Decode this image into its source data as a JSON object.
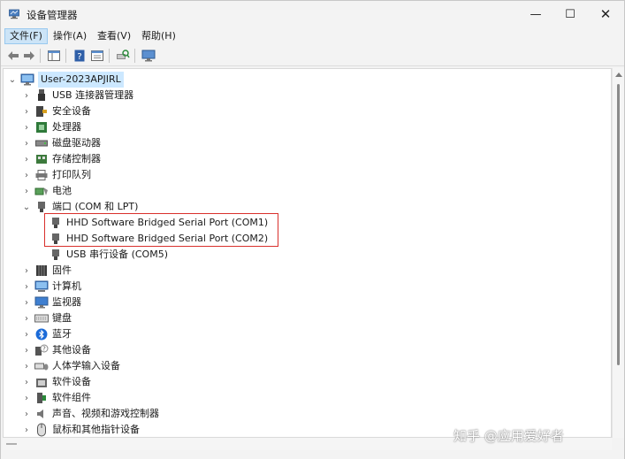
{
  "window": {
    "title": "设备管理器",
    "minimize_glyph": "—",
    "maximize_glyph": "☐",
    "close_glyph": "✕"
  },
  "menu": [
    {
      "label": "文件(F)"
    },
    {
      "label": "操作(A)"
    },
    {
      "label": "查看(V)"
    },
    {
      "label": "帮助(H)"
    }
  ],
  "tree": {
    "root": "User-2023APJIRL",
    "items": [
      {
        "label": "USB 连接器管理器",
        "icon": "usb-connector-icon"
      },
      {
        "label": "安全设备",
        "icon": "security-device-icon"
      },
      {
        "label": "处理器",
        "icon": "processor-icon"
      },
      {
        "label": "磁盘驱动器",
        "icon": "disk-drive-icon"
      },
      {
        "label": "存储控制器",
        "icon": "storage-controller-icon"
      },
      {
        "label": "打印队列",
        "icon": "printer-icon"
      },
      {
        "label": "电池",
        "icon": "battery-icon"
      },
      {
        "label": "端口 (COM 和 LPT)",
        "icon": "port-icon"
      },
      {
        "label": "HHD Software Bridged Serial Port (COM1)",
        "icon": "serial-port-icon"
      },
      {
        "label": "HHD Software Bridged Serial Port (COM2)",
        "icon": "serial-port-icon"
      },
      {
        "label": "USB 串行设备 (COM5)",
        "icon": "serial-port-icon"
      },
      {
        "label": "固件",
        "icon": "firmware-icon"
      },
      {
        "label": "计算机",
        "icon": "computer-icon"
      },
      {
        "label": "监视器",
        "icon": "monitor-icon"
      },
      {
        "label": "键盘",
        "icon": "keyboard-icon"
      },
      {
        "label": "蓝牙",
        "icon": "bluetooth-icon"
      },
      {
        "label": "其他设备",
        "icon": "other-device-icon"
      },
      {
        "label": "人体学输入设备",
        "icon": "hid-icon"
      },
      {
        "label": "软件设备",
        "icon": "software-device-icon"
      },
      {
        "label": "软件组件",
        "icon": "software-component-icon"
      },
      {
        "label": "声音、视频和游戏控制器",
        "icon": "sound-icon"
      },
      {
        "label": "鼠标和其他指针设备",
        "icon": "mouse-icon"
      }
    ]
  },
  "watermark": "知乎 @应用爱好者",
  "colors": {
    "selection": "#cce8ff",
    "highlight_border": "#d9302c",
    "menu_active": "#cce4f7"
  }
}
